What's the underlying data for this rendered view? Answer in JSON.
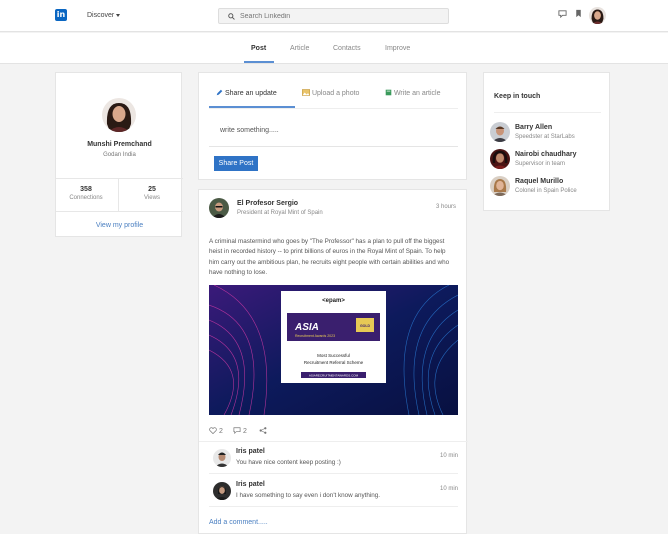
{
  "header": {
    "logo_text": "in",
    "discover_label": "Discover",
    "search_placeholder": "Search Linkedin"
  },
  "nav_tabs": [
    "Post",
    "Article",
    "Contacts",
    "Improve"
  ],
  "profile": {
    "name": "Munshi Premchand",
    "location": "Godan India",
    "connections_count": "358",
    "connections_label": "Connections",
    "views_count": "25",
    "views_label": "Views",
    "view_profile_label": "View my profile"
  },
  "composer": {
    "tabs": [
      "Share an update",
      "Upload a photo",
      "Write an article"
    ],
    "placeholder": "write something.....",
    "share_button": "Share Post"
  },
  "post": {
    "author": "El Profesor Sergio",
    "role": "President at Royal Mint of Spain",
    "time": "3 hours",
    "text": "A criminal mastermind who goes by \"The Professor\" has a plan to pull off the biggest heist in recorded history -- to print billions of euros in the Royal Mint of Spain. To help him carry out the ambitious plan, he recruits eight people with certain abilities and who have nothing to lose.",
    "media": {
      "brand": "<epam>",
      "award_title": "ASIA",
      "award_subtitle": "Recruitment Awards 2023",
      "badge": "GOLD",
      "caption_line1": "Most Successful",
      "caption_line2": "Recruitment Referral Scheme",
      "footer": "ASIARECRUITMENTAWARDS.COM"
    },
    "likes": "2",
    "comments_count": "2",
    "comments": [
      {
        "name": "Iris patel",
        "text": "You have nice content keep posting :)",
        "time": "10 min"
      },
      {
        "name": "Iris patel",
        "text": "I have something to say even i don't know anything.",
        "time": "10 min"
      }
    ],
    "add_comment_label": "Add a comment....."
  },
  "keep_in_touch": {
    "title": "Keep in touch",
    "contacts": [
      {
        "name": "Barry Allen",
        "role": "Speedster at StarLabs"
      },
      {
        "name": "Nairobi chaudhary",
        "role": "Supervisor in team"
      },
      {
        "name": "Raquel Murillo",
        "role": "Colonel in Spain Police"
      }
    ]
  },
  "icons": [
    "search-icon",
    "message-icon",
    "bookmark-icon",
    "pencil-icon",
    "photo-icon",
    "book-icon",
    "heart-icon",
    "comment-icon",
    "share-icon"
  ],
  "colors": {
    "accent": "#2f73c6",
    "link": "#4a7fc1",
    "brand": "#0a66c2"
  }
}
